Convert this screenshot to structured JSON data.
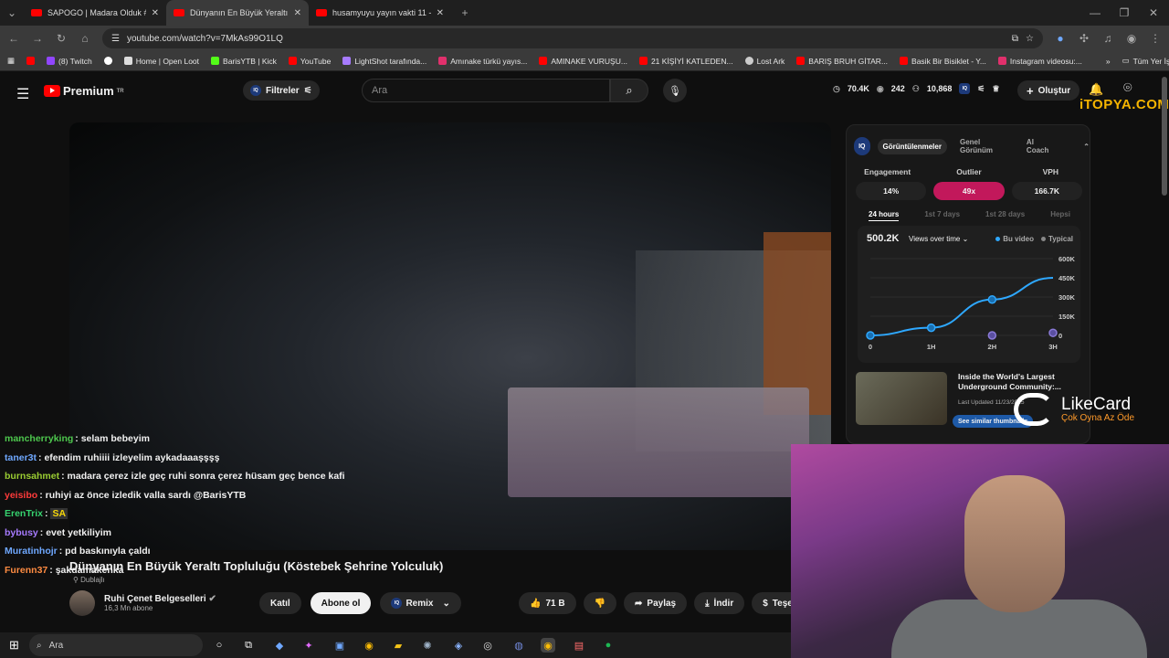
{
  "browser": {
    "tabs": [
      {
        "label": "SAPOGO | Madara Olduk #606",
        "active": false
      },
      {
        "label": "Dünyanın En Büyük Yeraltı Topl",
        "active": true
      },
      {
        "label": "husamyuyu yayın vakti 11 - Yo",
        "active": false
      }
    ],
    "url": "youtube.com/watch?v=7MkAs99O1LQ",
    "bookmarks": [
      "(8) Twitch",
      "Home | Open Loot",
      "BarisYTB | Kick",
      "YouTube",
      "LightShot tarafında...",
      "Amınake türkü yayıs...",
      "AMINAKE VURUŞU...",
      "21 KİŞİYİ KATLEDEN...",
      "Lost Ark",
      "BARIŞ BRUH GİTAR...",
      "Basik Bir Bisiklet - Y...",
      "Instagram videosu:..."
    ],
    "all_bookmarks": "Tüm Yer İşaretleri"
  },
  "yt": {
    "brand": "Premium",
    "region": "TR",
    "filters": "Filtreler",
    "search_placeholder": "Ara",
    "stats": [
      "70.4K",
      "242",
      "10,868"
    ],
    "create": "Oluştur",
    "overlay_brand": "iTOPYA.COM"
  },
  "chat": [
    {
      "user": "mancherryking",
      "color": "#4ec94e",
      "msg": "selam bebeyim"
    },
    {
      "user": "taner3t",
      "color": "#6fa8ff",
      "msg": "efendim ruhiiii izleyelim aykadaaaşşşş"
    },
    {
      "user": "burnsahmet",
      "color": "#9acd32",
      "msg": "madara çerez izle geç ruhi sonra çerez hüsam geç bence kafi"
    },
    {
      "user": "yeisibo",
      "color": "#ff3b3b",
      "msg": "ruhiyi az önce izledik valla sardı @BarisYTB"
    },
    {
      "user": "ErenTrix",
      "color": "#36d36f",
      "msg": "SA"
    },
    {
      "user": "bybusy",
      "color": "#a77bff",
      "msg": "evet yetkiliyim"
    },
    {
      "user": "Muratinhojr",
      "color": "#6fa8ff",
      "msg": "pd baskınıyla çaldı"
    },
    {
      "user": "Furenn37",
      "color": "#ff8c42",
      "msg": "şakdamakenka"
    }
  ],
  "video": {
    "title": "Dünyanın En Büyük Yeraltı Topluluğu (Köstebek Şehrine Yolculuk)",
    "dubbed": "Dublajlı",
    "channel": "Ruhi Çenet Belgeselleri",
    "subs": "16,3 Mn abone",
    "join": "Katıl",
    "subscribe": "Abone ol",
    "remix": "Remix",
    "likes": "71 B",
    "share": "Paylaş",
    "download": "İndir",
    "thanks": "Teşekkürler"
  },
  "panel": {
    "tabs": [
      "Görüntülenmeler",
      "Genel Görünüm",
      "AI Coach"
    ],
    "metrics": [
      {
        "label": "Engagement",
        "value": "14%"
      },
      {
        "label": "Outlier",
        "value": "49x"
      },
      {
        "label": "VPH",
        "value": "166.7K"
      }
    ],
    "ranges": [
      "24 hours",
      "1st 7 days",
      "1st 28 days",
      "Hepsi"
    ],
    "views": "500.2K",
    "views_select": "Views over time",
    "legend": [
      "Bu video",
      "Typical"
    ],
    "related_title": "Inside the World's Largest Underground Community:...",
    "related_updated": "Last Updated 11/23/2025",
    "related_btn": "See similar thumbnails"
  },
  "chart_data": {
    "type": "line",
    "x": [
      "0",
      "1H",
      "2H",
      "3H"
    ],
    "series": [
      {
        "name": "Bu video",
        "values": [
          0,
          60000,
          280000,
          450000
        ]
      },
      {
        "name": "Typical",
        "values": [
          0,
          0,
          0,
          20000
        ]
      }
    ],
    "ylim": [
      0,
      600000
    ],
    "yticks": [
      "600K",
      "450K",
      "300K",
      "150K",
      "0"
    ]
  },
  "likecard": {
    "name": "LikeCard",
    "tagline": "Çok Oyna  Az Öde"
  },
  "taskbar": {
    "search": "Ara"
  }
}
